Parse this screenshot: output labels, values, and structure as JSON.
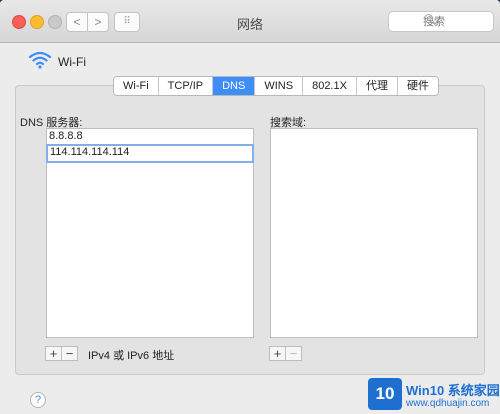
{
  "window": {
    "title": "网络",
    "search_placeholder": "搜索",
    "nav_back": "<",
    "nav_forward": ">",
    "grid_label": "⠿"
  },
  "service": {
    "name": "Wi-Fi"
  },
  "tabs": [
    {
      "label": "Wi-Fi",
      "active": false
    },
    {
      "label": "TCP/IP",
      "active": false
    },
    {
      "label": "DNS",
      "active": true
    },
    {
      "label": "WINS",
      "active": false
    },
    {
      "label": "802.1X",
      "active": false
    },
    {
      "label": "代理",
      "active": false
    },
    {
      "label": "硬件",
      "active": false
    }
  ],
  "dns": {
    "label": "DNS 服务器:",
    "servers": [
      "8.8.8.8",
      "114.114.114.114"
    ],
    "add_label": "+",
    "remove_label": "−",
    "hint": "IPv4 或 IPv6 地址"
  },
  "search_domains": {
    "label": "搜索域:",
    "add_label": "+",
    "remove_label": "−"
  },
  "help_label": "?",
  "watermark": {
    "logo": "10",
    "title": "Win10 系统家园",
    "url": "www.qdhuajin.com"
  },
  "colors": {
    "accent": "#3d8ef8",
    "close": "#fc5f57",
    "minimize": "#fdbc2e"
  }
}
